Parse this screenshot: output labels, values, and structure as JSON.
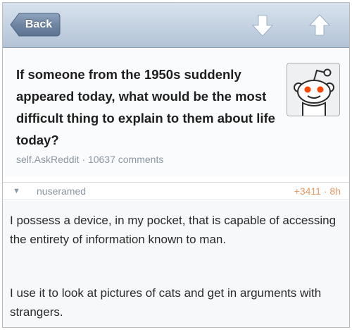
{
  "nav": {
    "back_label": "Back",
    "downvote_icon": "arrow-down-icon",
    "upvote_icon": "arrow-up-icon"
  },
  "post": {
    "title": "If someone from the 1950s suddenly appeared today, what would be the most difficult thing to explain to them about life today?",
    "subreddit": "self.AskReddit",
    "separator": "·",
    "comments": "10637 comments",
    "thumbnail_icon": "reddit-alien-icon"
  },
  "comment": {
    "author": "nuseramed",
    "score": "+3411",
    "separator": "·",
    "age": "8h",
    "paragraphs": [
      "I possess a device, in my pocket, that is capable of accessing the entirety of information known to man.",
      "I use it to look at pictures of cats and get in arguments with strangers."
    ]
  },
  "colors": {
    "nav_top": "#d9e3ee",
    "nav_bottom": "#b3c3d6",
    "back_button": "#6f86a3",
    "meta_text": "#8c97a4",
    "score": "#e69a63"
  }
}
